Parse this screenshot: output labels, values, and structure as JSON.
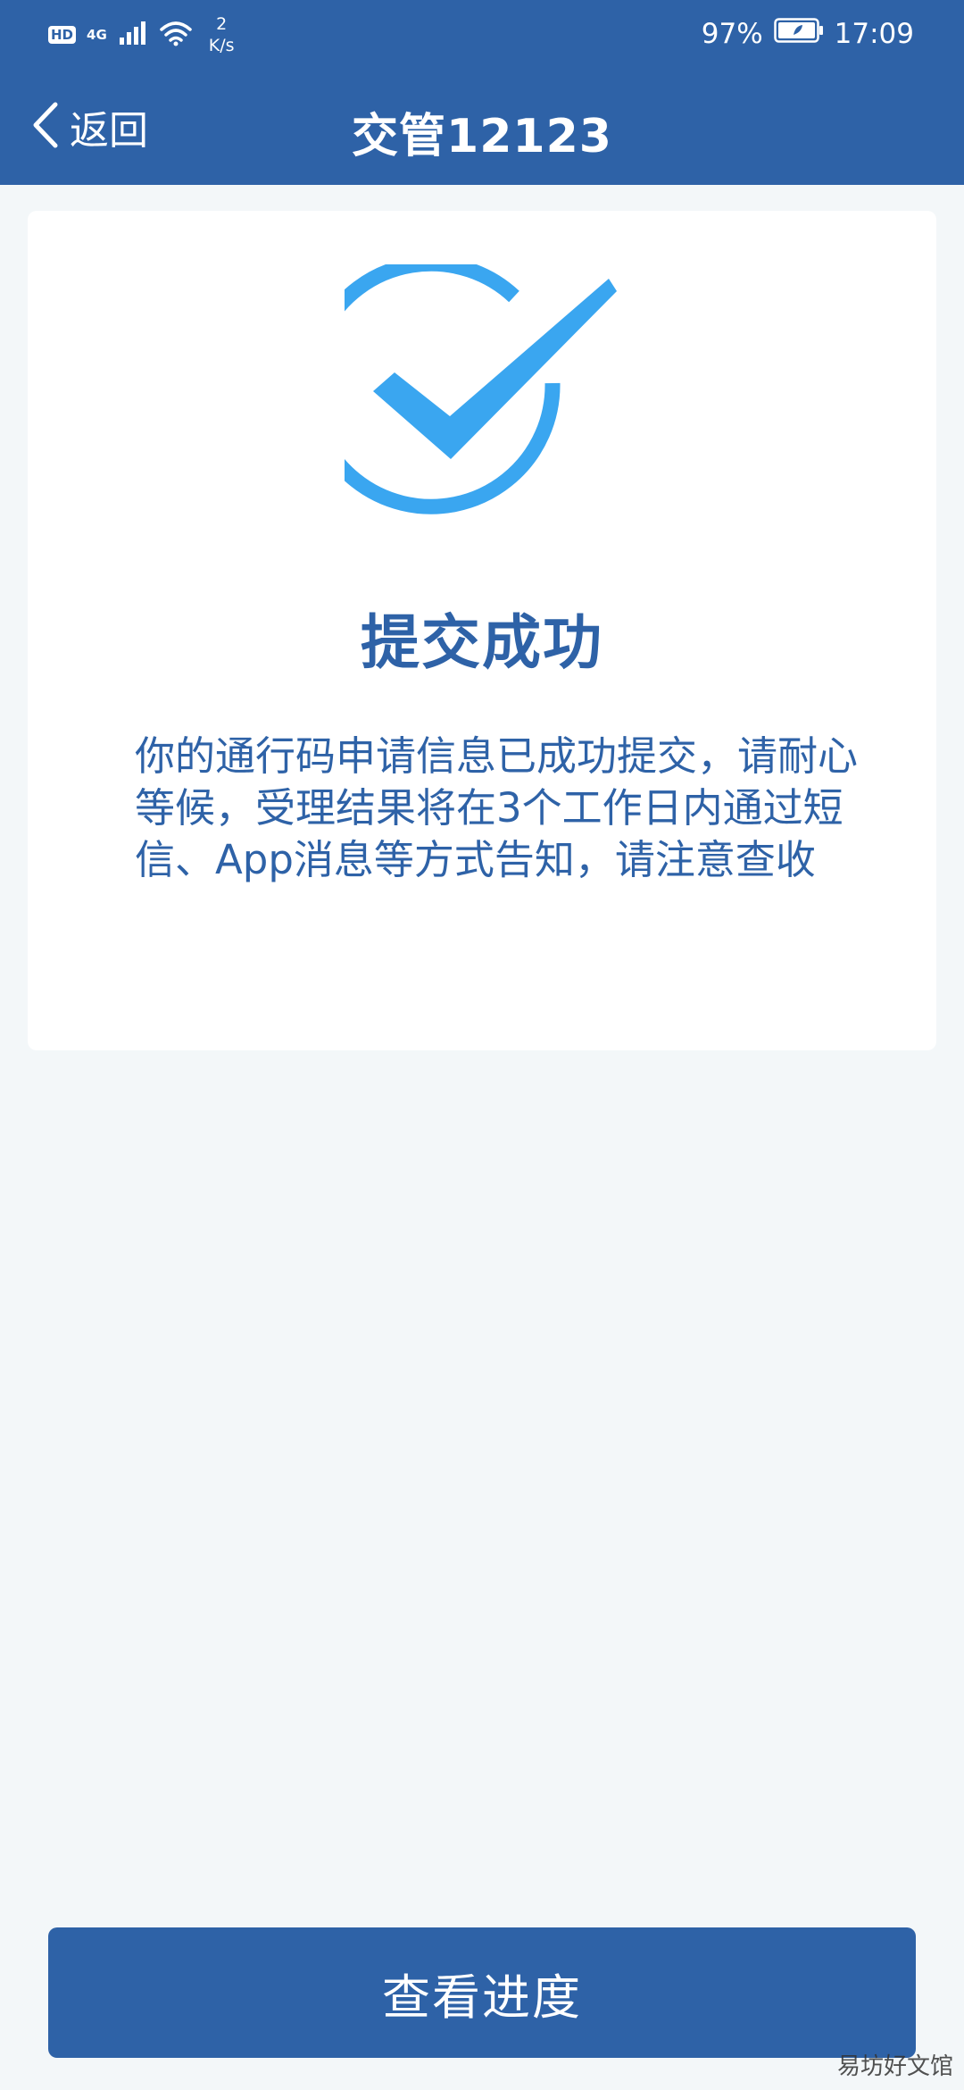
{
  "status_bar": {
    "hd": "HD",
    "network": "4G",
    "speed_value": "2",
    "speed_unit": "K/s",
    "battery": "97%",
    "time": "17:09"
  },
  "nav": {
    "back_label": "返回",
    "title": "交管12123"
  },
  "result": {
    "title": "提交成功",
    "message": "你的通行码申请信息已成功提交，请耐心等候，受理结果将在3个工作日内通过短信、App消息等方式告知，请注意查收"
  },
  "footer": {
    "button_label": "查看进度"
  },
  "watermark": "易坊好文馆",
  "colors": {
    "primary": "#2e62a7",
    "check": "#3aa6f0",
    "background": "#f3f7f9"
  },
  "icons": {
    "back": "chevron-left-icon",
    "success": "check-circle-icon",
    "signal": "signal-icon",
    "wifi": "wifi-icon",
    "battery": "battery-icon"
  }
}
